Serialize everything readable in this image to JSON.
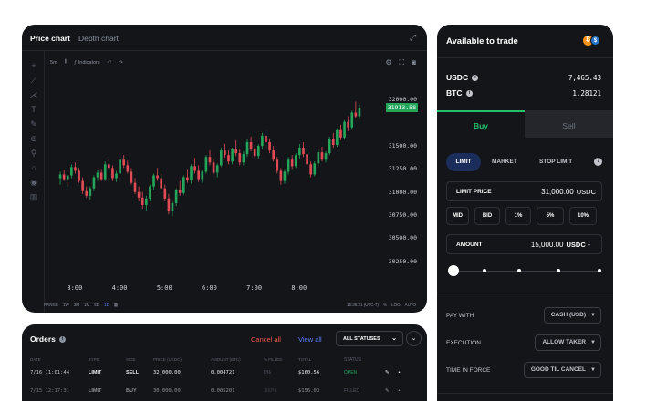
{
  "colors": {
    "up": "#23a55a",
    "down": "#e14b56",
    "accent_buy": "#23c16b",
    "accent_link": "#5b7cfa",
    "cancel": "#f05350"
  },
  "chart": {
    "tab_price": "Price chart",
    "tab_depth": "Depth chart",
    "interval": "5m",
    "indicators_label": "Indicators",
    "y_ticks": [
      "32000.00",
      "31500.00",
      "31250.00",
      "31000.00",
      "30750.00",
      "30500.00",
      "30250.00"
    ],
    "last_price": "31913.58",
    "x_ticks": [
      "3:00",
      "4:00",
      "5:00",
      "6:00",
      "7:00",
      "8:00"
    ],
    "range_label": "RANGE",
    "ranges": [
      "1W",
      "3M",
      "1M",
      "5D",
      "1D"
    ],
    "time_label": "15:35:21 (UTC-7)",
    "scale_options": [
      "%",
      "LOG",
      "AUTO"
    ]
  },
  "chart_data": {
    "type": "candlestick",
    "x_start": "2:40",
    "x_step_minutes": 5,
    "ylim": [
      30150,
      32200
    ],
    "x_ticks": [
      "3:00",
      "4:00",
      "5:00",
      "6:00",
      "7:00",
      "8:00"
    ],
    "candles": [
      [
        31150,
        31220,
        31080,
        31190
      ],
      [
        31190,
        31240,
        31120,
        31140
      ],
      [
        31140,
        31200,
        31060,
        31180
      ],
      [
        31180,
        31300,
        31150,
        31270
      ],
      [
        31270,
        31320,
        31200,
        31230
      ],
      [
        31230,
        31260,
        31100,
        31120
      ],
      [
        31120,
        31160,
        30980,
        31010
      ],
      [
        31010,
        31060,
        30940,
        30960
      ],
      [
        30960,
        31060,
        30920,
        31040
      ],
      [
        31040,
        31180,
        31010,
        31160
      ],
      [
        31160,
        31240,
        31120,
        31210
      ],
      [
        31210,
        31250,
        31120,
        31140
      ],
      [
        31140,
        31330,
        31120,
        31300
      ],
      [
        31300,
        31350,
        31240,
        31260
      ],
      [
        31260,
        31290,
        31120,
        31150
      ],
      [
        31150,
        31230,
        31110,
        31200
      ],
      [
        31200,
        31380,
        31170,
        31350
      ],
      [
        31350,
        31400,
        31260,
        31290
      ],
      [
        31290,
        31340,
        31200,
        31220
      ],
      [
        31220,
        31260,
        31080,
        31100
      ],
      [
        31100,
        31150,
        30980,
        31000
      ],
      [
        31000,
        31060,
        30900,
        30940
      ],
      [
        30940,
        31000,
        30820,
        30860
      ],
      [
        30860,
        30960,
        30800,
        30930
      ],
      [
        30930,
        31080,
        30900,
        31060
      ],
      [
        31060,
        31200,
        31020,
        31180
      ],
      [
        31180,
        31260,
        31120,
        31150
      ],
      [
        31150,
        31200,
        31020,
        31040
      ],
      [
        31040,
        31080,
        30900,
        30930
      ],
      [
        30930,
        30980,
        30760,
        30800
      ],
      [
        30800,
        30900,
        30740,
        30880
      ],
      [
        30880,
        31040,
        30850,
        31020
      ],
      [
        31020,
        31120,
        30960,
        30990
      ],
      [
        30990,
        31180,
        30970,
        31160
      ],
      [
        31160,
        31250,
        31100,
        31130
      ],
      [
        31130,
        31300,
        31090,
        31280
      ],
      [
        31280,
        31370,
        31200,
        31230
      ],
      [
        31230,
        31290,
        31110,
        31140
      ],
      [
        31140,
        31240,
        31100,
        31220
      ],
      [
        31220,
        31400,
        31200,
        31380
      ],
      [
        31380,
        31450,
        31290,
        31320
      ],
      [
        31320,
        31360,
        31190,
        31210
      ],
      [
        31210,
        31310,
        31160,
        31290
      ],
      [
        31290,
        31480,
        31270,
        31450
      ],
      [
        31450,
        31520,
        31370,
        31400
      ],
      [
        31400,
        31450,
        31300,
        31330
      ],
      [
        31330,
        31480,
        31300,
        31460
      ],
      [
        31460,
        31560,
        31390,
        31420
      ],
      [
        31420,
        31470,
        31290,
        31320
      ],
      [
        31320,
        31440,
        31290,
        31410
      ],
      [
        31410,
        31570,
        31380,
        31540
      ],
      [
        31540,
        31600,
        31440,
        31470
      ],
      [
        31470,
        31510,
        31370,
        31390
      ],
      [
        31390,
        31520,
        31360,
        31500
      ],
      [
        31500,
        31640,
        31460,
        31610
      ],
      [
        31610,
        31660,
        31510,
        31540
      ],
      [
        31540,
        31580,
        31420,
        31450
      ],
      [
        31450,
        31500,
        31330,
        31350
      ],
      [
        31350,
        31380,
        31200,
        31230
      ],
      [
        31230,
        31260,
        31080,
        31120
      ],
      [
        31120,
        31250,
        31090,
        31220
      ],
      [
        31220,
        31380,
        31190,
        31350
      ],
      [
        31350,
        31400,
        31250,
        31280
      ],
      [
        31280,
        31420,
        31260,
        31400
      ],
      [
        31400,
        31520,
        31360,
        31480
      ],
      [
        31480,
        31540,
        31380,
        31410
      ],
      [
        31410,
        31450,
        31270,
        31300
      ],
      [
        31300,
        31330,
        31160,
        31190
      ],
      [
        31190,
        31330,
        31170,
        31310
      ],
      [
        31310,
        31460,
        31280,
        31430
      ],
      [
        31430,
        31490,
        31330,
        31350
      ],
      [
        31350,
        31440,
        31320,
        31420
      ],
      [
        31420,
        31600,
        31400,
        31570
      ],
      [
        31570,
        31640,
        31480,
        31510
      ],
      [
        31510,
        31690,
        31490,
        31670
      ],
      [
        31670,
        31730,
        31560,
        31590
      ],
      [
        31590,
        31780,
        31570,
        31760
      ],
      [
        31760,
        31820,
        31660,
        31700
      ],
      [
        31700,
        31880,
        31680,
        31860
      ],
      [
        31860,
        31980,
        31800,
        31820
      ],
      [
        31820,
        31950,
        31790,
        31913.58
      ]
    ]
  },
  "orders": {
    "title": "Orders",
    "cancel_all": "Cancel all",
    "view_all": "View all",
    "status_filter": "ALL STATUSES",
    "columns": [
      "DATE",
      "TYPE",
      "SIDE",
      "PRICE (USDC)",
      "AMOUNT (BTC)",
      "% FILLED",
      "TOTAL",
      "STATUS"
    ],
    "rows": [
      {
        "date": "7/16 11:01:44",
        "type": "LIMIT",
        "side": "SELL",
        "price": "32,000.00",
        "amount": "0.004721",
        "filled": "0%",
        "total": "$160.56",
        "status": "OPEN",
        "status_color": "#23a55a",
        "side_color": "#ffffff"
      },
      {
        "date": "7/15 12:17:31",
        "type": "LIMIT",
        "side": "BUY",
        "price": "30,000.00",
        "amount": "0.005201",
        "filled": "100%",
        "total": "$156.03",
        "status": "FILLED",
        "status_color": "#8a919e",
        "side_color": "#ffffff"
      }
    ]
  },
  "trade": {
    "title": "Available to trade",
    "balances": [
      {
        "asset": "USDC",
        "value": "7,465.43"
      },
      {
        "asset": "BTC",
        "value": "1.28121"
      }
    ],
    "tab_buy": "Buy",
    "tab_sell": "Sell",
    "order_types": [
      "LIMIT",
      "MARKET",
      "STOP LIMIT"
    ],
    "limit_price_label": "LIMIT PRICE",
    "limit_price_value": "31,000.00",
    "limit_price_unit": "USDC",
    "chips": [
      "MID",
      "BID",
      "1%",
      "5%",
      "10%"
    ],
    "amount_label": "AMOUNT",
    "amount_value": "15,000.00",
    "amount_unit": "USDC",
    "slider_fraction": 0,
    "pay_with_label": "PAY WITH",
    "pay_with_value": "CASH (USD)",
    "execution_label": "EXECUTION",
    "execution_value": "ALLOW TAKER",
    "tif_label": "TIME IN FORCE",
    "tif_value": "GOOD TIL CANCEL"
  }
}
